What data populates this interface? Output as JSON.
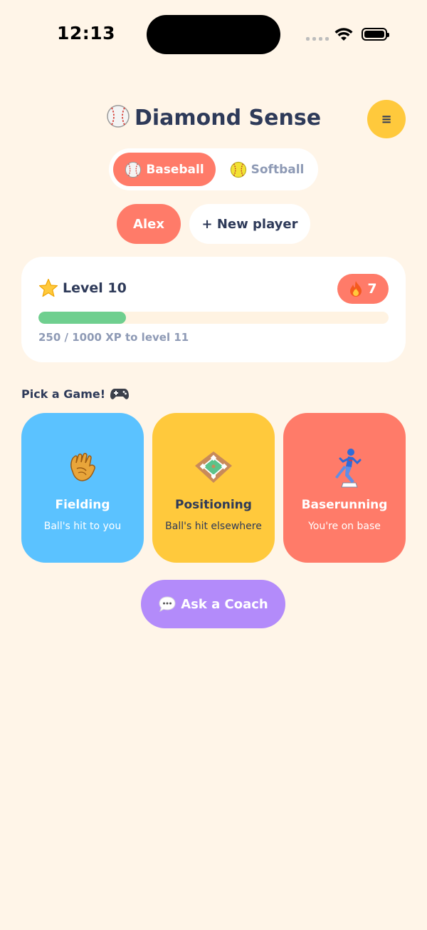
{
  "status_bar": {
    "time": "12:13"
  },
  "header": {
    "title": "Diamond Sense",
    "title_icon": "baseball-icon",
    "menu_glyph": "≡"
  },
  "sport_toggle": {
    "options": [
      {
        "label": "Baseball",
        "icon": "baseball-icon",
        "selected": true
      },
      {
        "label": "Softball",
        "icon": "softball-icon",
        "selected": false
      }
    ]
  },
  "players": {
    "active": "Alex",
    "new_label": "+ New player"
  },
  "level": {
    "title": "Level 10",
    "icon": "star-icon",
    "streak": "7",
    "streak_icon": "fire-icon",
    "progress_fraction": 0.25,
    "xp_text": "250 / 1000 XP to level 11",
    "colors": {
      "progress": "#6FCF8F",
      "streak": "#FF7B69"
    }
  },
  "games": {
    "section_title": "Pick a Game!",
    "section_icon": "gamepad-icon",
    "cards": [
      {
        "name": "Fielding",
        "desc": "Ball's hit to you",
        "icon": "glove-icon",
        "color": "#5BC2FF"
      },
      {
        "name": "Positioning",
        "desc": "Ball's hit elsewhere",
        "icon": "infield-diamond-icon",
        "color": "#FFC93C"
      },
      {
        "name": "Baserunning",
        "desc": "You're on base",
        "icon": "runner-icon",
        "color": "#FF7B69"
      }
    ]
  },
  "coach_button": {
    "label": "Ask a Coach",
    "icon": "speech-bubble-icon",
    "color": "#B38BFA"
  }
}
